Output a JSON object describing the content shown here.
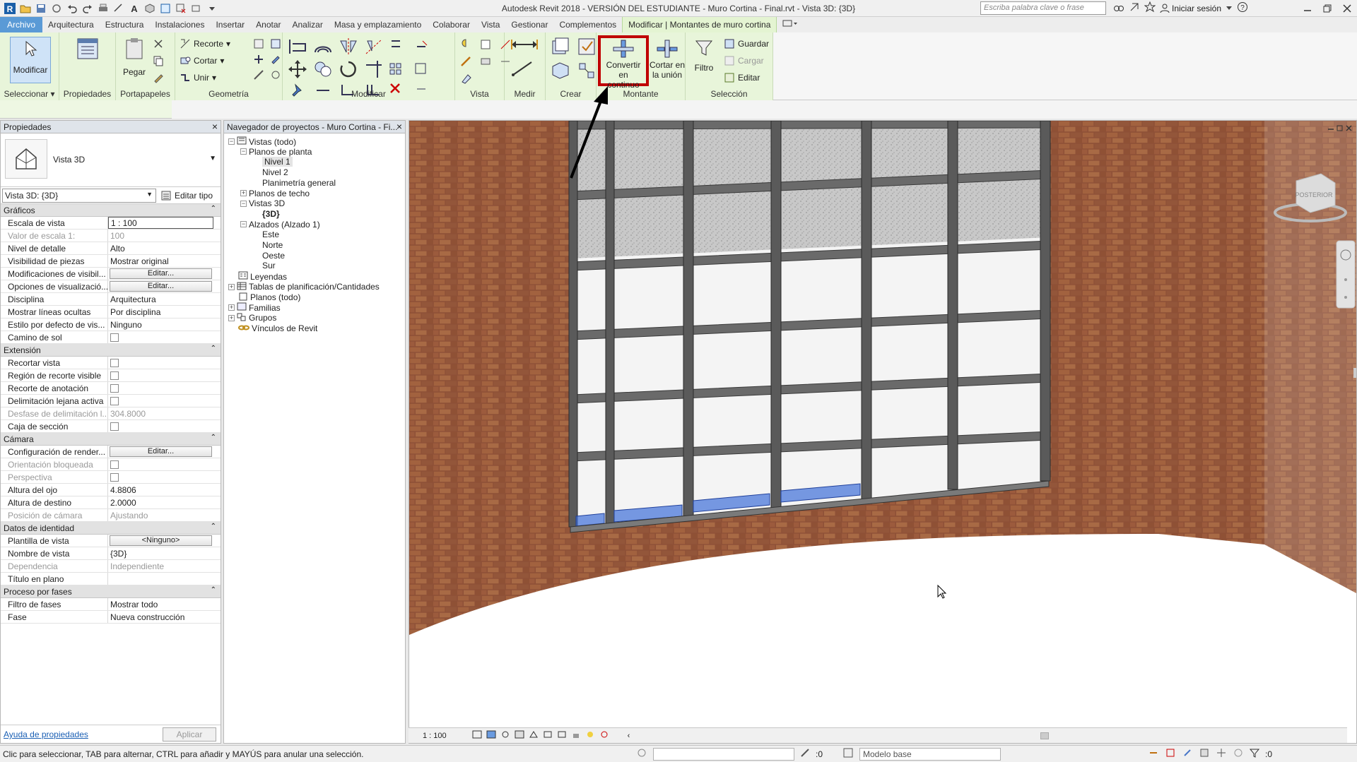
{
  "window": {
    "title": "Autodesk Revit 2018 - VERSIÓN DEL ESTUDIANTE -    Muro Cortina - Final.rvt - Vista 3D: {3D}",
    "search_placeholder": "Escriba palabra clave o frase",
    "signin_label": "Iniciar sesión"
  },
  "tabs": [
    "Archivo",
    "Arquitectura",
    "Estructura",
    "Instalaciones",
    "Insertar",
    "Anotar",
    "Analizar",
    "Masa y emplazamiento",
    "Colaborar",
    "Vista",
    "Gestionar",
    "Complementos",
    "Modificar | Montantes de muro cortina"
  ],
  "ribbon": {
    "modify_label": "Modificar",
    "select_label": "Seleccionar",
    "properties_label": "Propiedades",
    "paste_label": "Pegar",
    "clipboard_label": "Portapapeles",
    "geometry": {
      "cut": "Recorte",
      "cortar": "Cortar",
      "unir": "Unir",
      "label": "Geometría"
    },
    "modify_panel_label": "Modificar",
    "view_label": "Vista",
    "measure_label": "Medir",
    "create_label": "Crear",
    "montante": {
      "convert_line1": "Convertir en",
      "convert_line2": "continuo",
      "cut_line1": "Cortar en",
      "cut_line2": "la unión",
      "label": "Montante"
    },
    "selection": {
      "filter": "Filtro",
      "save": "Guardar",
      "load": "Cargar",
      "edit": "Editar",
      "label": "Selección"
    }
  },
  "properties": {
    "header": "Propiedades",
    "type_name": "Vista 3D",
    "instance_selector": "Vista 3D: {3D}",
    "edit_type": "Editar tipo",
    "sections": [
      {
        "title": "Gráficos",
        "rows": [
          {
            "k": "Escala de vista",
            "v": "1 : 100",
            "kind": "input"
          },
          {
            "k": "Valor de escala    1:",
            "v": "100",
            "kind": "dis"
          },
          {
            "k": "Nivel de detalle",
            "v": "Alto",
            "kind": "text"
          },
          {
            "k": "Visibilidad de piezas",
            "v": "Mostrar original",
            "kind": "text"
          },
          {
            "k": "Modificaciones de visibil...",
            "v": "Editar...",
            "kind": "button"
          },
          {
            "k": "Opciones de visualizació...",
            "v": "Editar...",
            "kind": "button"
          },
          {
            "k": "Disciplina",
            "v": "Arquitectura",
            "kind": "text"
          },
          {
            "k": "Mostrar líneas ocultas",
            "v": "Por disciplina",
            "kind": "text"
          },
          {
            "k": "Estilo por defecto de vis...",
            "v": "Ninguno",
            "kind": "text"
          },
          {
            "k": "Camino de sol",
            "v": "",
            "kind": "check"
          }
        ]
      },
      {
        "title": "Extensión",
        "rows": [
          {
            "k": "Recortar vista",
            "v": "",
            "kind": "check"
          },
          {
            "k": "Región de recorte visible",
            "v": "",
            "kind": "check"
          },
          {
            "k": "Recorte de anotación",
            "v": "",
            "kind": "check"
          },
          {
            "k": "Delimitación lejana activa",
            "v": "",
            "kind": "check"
          },
          {
            "k": "Desfase de delimitación l...",
            "v": "304.8000",
            "kind": "dis"
          },
          {
            "k": "Caja de sección",
            "v": "",
            "kind": "check"
          }
        ]
      },
      {
        "title": "Cámara",
        "rows": [
          {
            "k": "Configuración de render...",
            "v": "Editar...",
            "kind": "button"
          },
          {
            "k": "Orientación bloqueada",
            "v": "",
            "kind": "checkdis"
          },
          {
            "k": "Perspectiva",
            "v": "",
            "kind": "checkdis"
          },
          {
            "k": "Altura del ojo",
            "v": "4.8806",
            "kind": "text"
          },
          {
            "k": "Altura de destino",
            "v": "2.0000",
            "kind": "text"
          },
          {
            "k": "Posición de cámara",
            "v": "Ajustando",
            "kind": "dis"
          }
        ]
      },
      {
        "title": "Datos de identidad",
        "rows": [
          {
            "k": "Plantilla de vista",
            "v": "<Ninguno>",
            "kind": "button"
          },
          {
            "k": "Nombre de vista",
            "v": "{3D}",
            "kind": "text"
          },
          {
            "k": "Dependencia",
            "v": "Independiente",
            "kind": "dis"
          },
          {
            "k": "Título en plano",
            "v": "",
            "kind": "text"
          }
        ]
      },
      {
        "title": "Proceso por fases",
        "rows": [
          {
            "k": "Filtro de fases",
            "v": "Mostrar todo",
            "kind": "text"
          },
          {
            "k": "Fase",
            "v": "Nueva construcción",
            "kind": "text"
          }
        ]
      }
    ],
    "help_link": "Ayuda de propiedades",
    "apply": "Aplicar"
  },
  "browser": {
    "header": "Navegador de proyectos - Muro Cortina - Fi...",
    "items": [
      {
        "label": "Vistas (todo)",
        "level": 0,
        "tog": "−",
        "icon": "views-icon"
      },
      {
        "label": "Planos de planta",
        "level": 1,
        "tog": "−"
      },
      {
        "label": "Nivel 1",
        "level": 2,
        "selected": true
      },
      {
        "label": "Nivel 2",
        "level": 2
      },
      {
        "label": "Planimetría general",
        "level": 2
      },
      {
        "label": "Planos de techo",
        "level": 1,
        "tog": "+"
      },
      {
        "label": "Vistas 3D",
        "level": 1,
        "tog": "−"
      },
      {
        "label": "{3D}",
        "level": 2,
        "bold": true
      },
      {
        "label": "Alzados (Alzado 1)",
        "level": 1,
        "tog": "−"
      },
      {
        "label": "Este",
        "level": 2
      },
      {
        "label": "Norte",
        "level": 2
      },
      {
        "label": "Oeste",
        "level": 2
      },
      {
        "label": "Sur",
        "level": 2
      },
      {
        "label": "Leyendas",
        "level": 0,
        "icon": "legend-icon"
      },
      {
        "label": "Tablas de planificación/Cantidades",
        "level": 0,
        "tog": "+",
        "icon": "table-icon"
      },
      {
        "label": "Planos (todo)",
        "level": 0,
        "icon": "sheet-icon"
      },
      {
        "label": "Familias",
        "level": 0,
        "tog": "+",
        "icon": "family-icon"
      },
      {
        "label": "Grupos",
        "level": 0,
        "tog": "+",
        "icon": "group-icon"
      },
      {
        "label": "Vínculos de Revit",
        "level": 0,
        "icon": "link-icon"
      }
    ]
  },
  "viewport": {
    "scale": "1 : 100",
    "viewcube_label": "POSTERIOR"
  },
  "status": {
    "text": "Clic para seleccionar, TAB para alternar, CTRL para añadir y MAYÚS para anular una selección.",
    "model": "Modelo base",
    "sel_count": ":0",
    "filter_count": ":0"
  },
  "colors": {
    "context_tab": "#e4f4d2",
    "file_tab": "#5a9ad6",
    "highlight": "#c00000",
    "brick": "#9a5a3c",
    "mullion": "#5a5a5a",
    "selected_mullion": "#3e6fd8"
  }
}
